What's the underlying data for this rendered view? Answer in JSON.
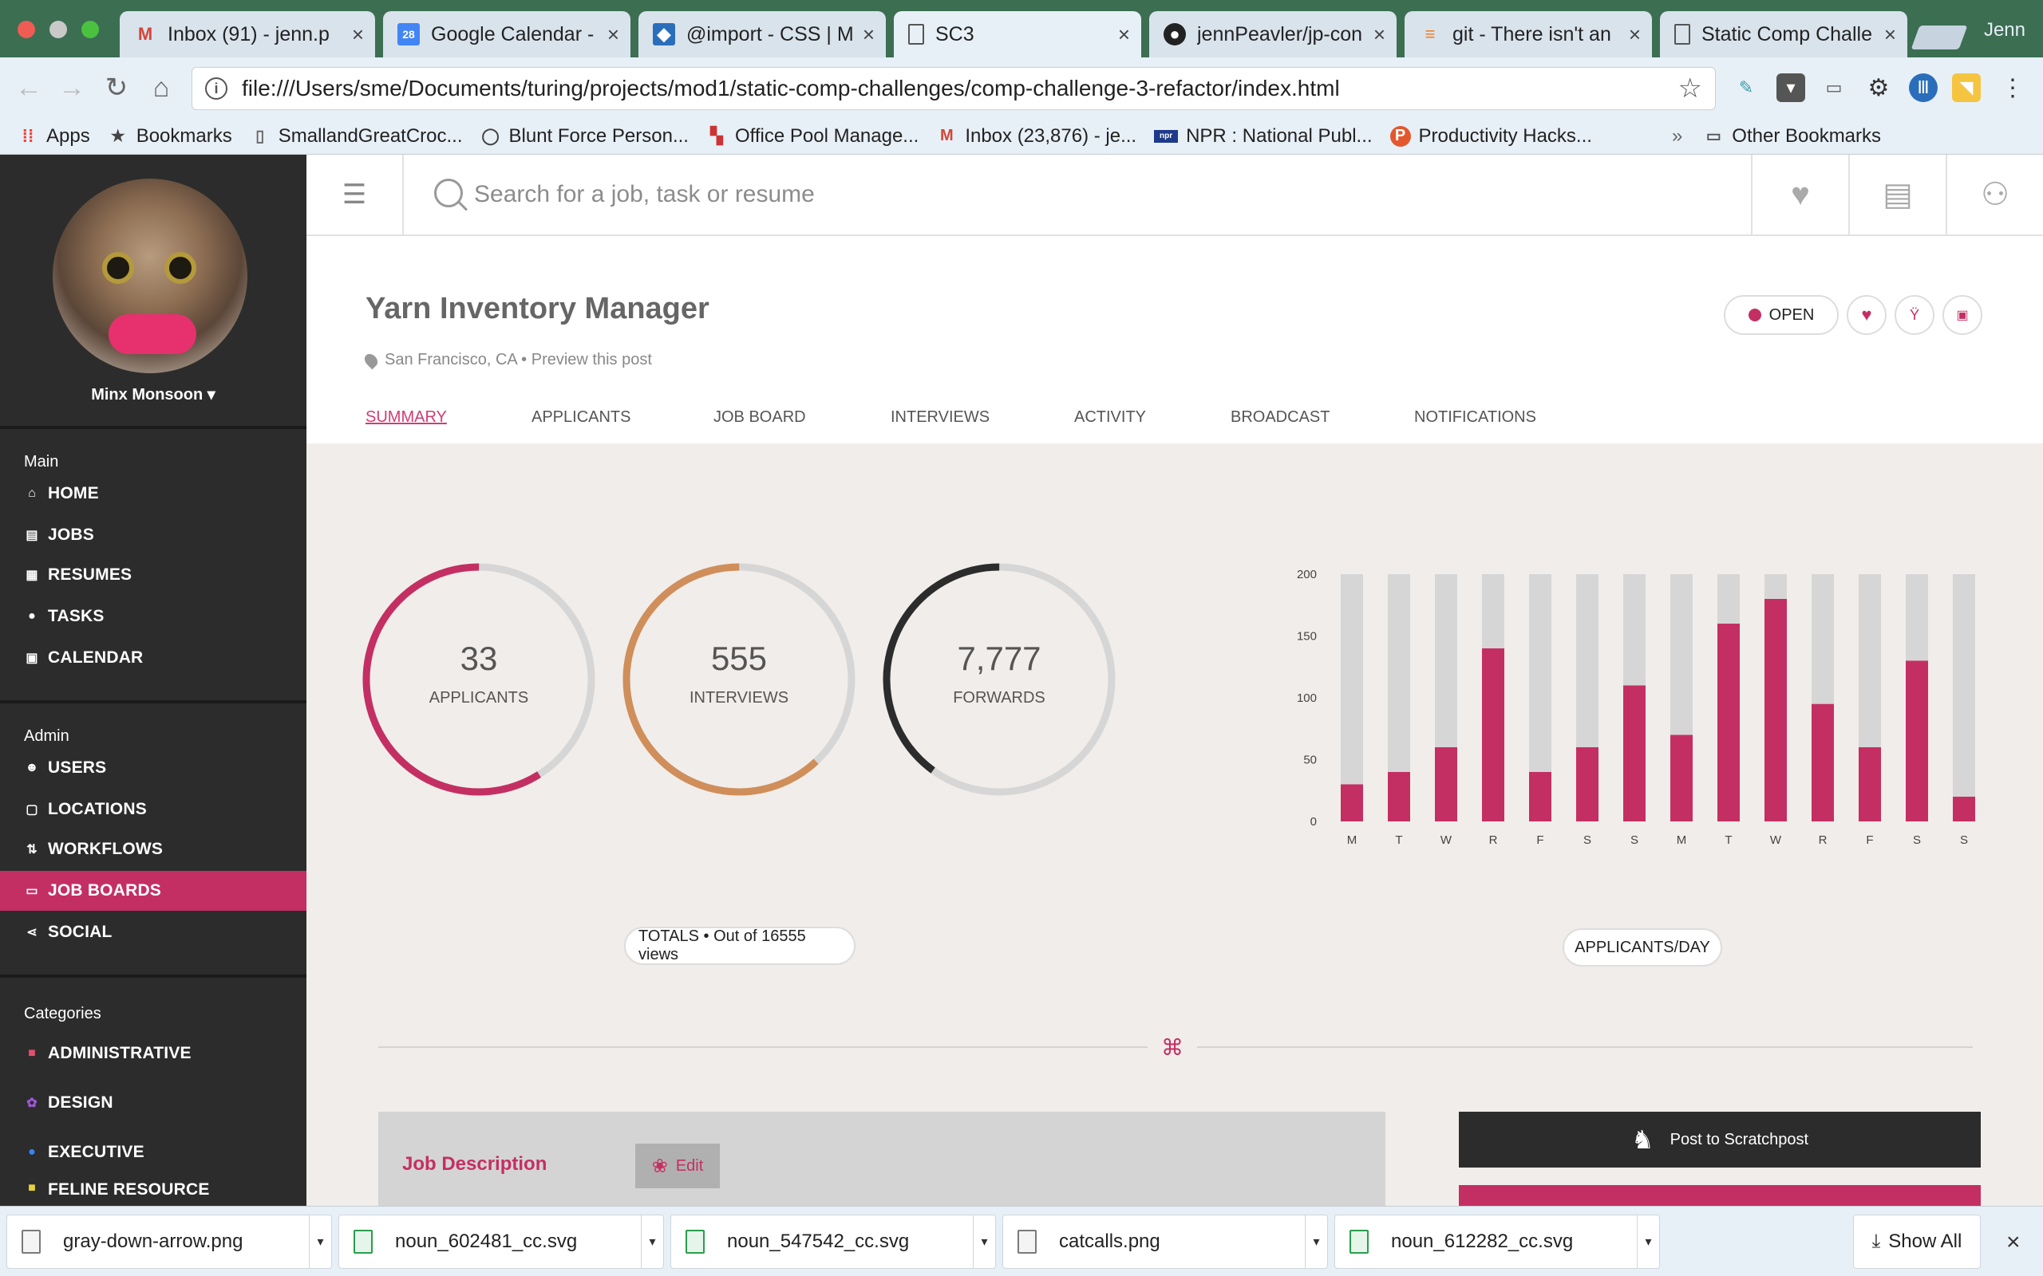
{
  "browser": {
    "tabs": [
      {
        "label": "Inbox (91) - jenn.p",
        "icon": "gmail-icon"
      },
      {
        "label": "Google Calendar -",
        "icon": "calendar-icon"
      },
      {
        "label": "@import - CSS | M",
        "icon": "mdn-icon"
      },
      {
        "label": "SC3",
        "icon": "page-icon"
      },
      {
        "label": "jennPeavler/jp-con",
        "icon": "github-icon"
      },
      {
        "label": "git - There isn't an",
        "icon": "stackoverflow-icon"
      },
      {
        "label": "Static Comp Challe",
        "icon": "page-icon"
      }
    ],
    "profile_name": "Jenn",
    "url": "file:///Users/sme/Documents/turing/projects/mod1/static-comp-challenges/comp-challenge-3-refactor/index.html",
    "bookmarks": [
      {
        "label": "Apps",
        "icon": "apps-icon"
      },
      {
        "label": "Bookmarks",
        "icon": "star-icon"
      },
      {
        "label": "SmallandGreatCroc...",
        "icon": "page-icon"
      },
      {
        "label": "Blunt Force Person...",
        "icon": "circle-icon"
      },
      {
        "label": "Office Pool Manage...",
        "icon": "office-pool-icon"
      },
      {
        "label": "Inbox (23,876) - je...",
        "icon": "gmail-icon"
      },
      {
        "label": "NPR : National Publ...",
        "icon": "npr-icon"
      },
      {
        "label": "Productivity Hacks...",
        "icon": "p-icon"
      }
    ],
    "bookmarks_overflow": "»",
    "other_bookmarks": "Other Bookmarks"
  },
  "app": {
    "user_name": "Minx Monsoon ▾",
    "search_placeholder": "Search for a job, task or resume",
    "nav_sections": [
      {
        "heading": "Main",
        "items": [
          {
            "label": "HOME",
            "icon": "home-icon"
          },
          {
            "label": "JOBS",
            "icon": "briefcase-icon"
          },
          {
            "label": "RESUMES",
            "icon": "document-icon"
          },
          {
            "label": "TASKS",
            "icon": "task-icon"
          },
          {
            "label": "CALENDAR",
            "icon": "calendar-icon"
          }
        ]
      },
      {
        "heading": "Admin",
        "items": [
          {
            "label": "USERS",
            "icon": "users-icon"
          },
          {
            "label": "LOCATIONS",
            "icon": "location-icon"
          },
          {
            "label": "WORKFLOWS",
            "icon": "workflow-icon"
          },
          {
            "label": "JOB BOARDS",
            "icon": "board-icon",
            "active": true
          },
          {
            "label": "SOCIAL",
            "icon": "share-icon"
          }
        ]
      },
      {
        "heading": "Categories",
        "items": [
          {
            "label": "ADMINISTRATIVE",
            "icon": "square-icon",
            "color": "#e0506e"
          },
          {
            "label": "DESIGN",
            "icon": "flower-icon",
            "color": "#9b59d6"
          },
          {
            "label": "EXECUTIVE",
            "icon": "circle-icon",
            "color": "#3b82f6"
          },
          {
            "label": "FELINE RESOURCE",
            "icon": "square-icon",
            "color": "#e6d23a"
          }
        ]
      }
    ],
    "job": {
      "title": "Yarn Inventory Manager",
      "location": "San Francisco, CA • Preview this post",
      "status": "OPEN"
    },
    "tabs": [
      {
        "label": "SUMMARY",
        "active": true
      },
      {
        "label": "APPLICANTS"
      },
      {
        "label": "JOB BOARD"
      },
      {
        "label": "INTERVIEWS"
      },
      {
        "label": "ACTIVITY"
      },
      {
        "label": "BROADCAST"
      },
      {
        "label": "NOTIFICATIONS"
      }
    ],
    "stats": [
      {
        "value": "33",
        "label": "APPLICANTS",
        "color": "#c42f63",
        "fraction": 0.59
      },
      {
        "value": "555",
        "label": "INTERVIEWS",
        "color": "#d08e5a",
        "fraction": 0.62
      },
      {
        "value": "7,777",
        "label": "FORWARDS",
        "color": "#2c2c2c",
        "fraction": 0.4
      }
    ],
    "totals_label": "TOTALS • Out of 16555 views",
    "chart_label": "APPLICANTS/DAY",
    "description_title": "Job Description",
    "edit_label": "Edit",
    "post_label": "Post to Scratchpost",
    "colors": {
      "accent": "#c42f63",
      "sidebar": "#2c2c2c",
      "track": "#d6d6d6"
    }
  },
  "chart_data": {
    "type": "bar",
    "categories": [
      "M",
      "T",
      "W",
      "R",
      "F",
      "S",
      "S",
      "M",
      "T",
      "W",
      "R",
      "F",
      "S",
      "S"
    ],
    "series": [
      {
        "values": [
          30,
          40,
          60,
          140,
          40,
          60,
          110,
          70,
          160,
          180,
          95,
          60,
          130,
          20
        ]
      }
    ],
    "max": 200,
    "ylim": [
      0,
      200
    ],
    "yticks": [
      0,
      50,
      100,
      150,
      200
    ],
    "grid": false
  },
  "downloads": {
    "items": [
      {
        "name": "gray-down-arrow.png",
        "type": "png"
      },
      {
        "name": "noun_602481_cc.svg",
        "type": "svg"
      },
      {
        "name": "noun_547542_cc.svg",
        "type": "svg"
      },
      {
        "name": "catcalls.png",
        "type": "png"
      },
      {
        "name": "noun_612282_cc.svg",
        "type": "svg"
      }
    ],
    "show_all": "Show All"
  }
}
